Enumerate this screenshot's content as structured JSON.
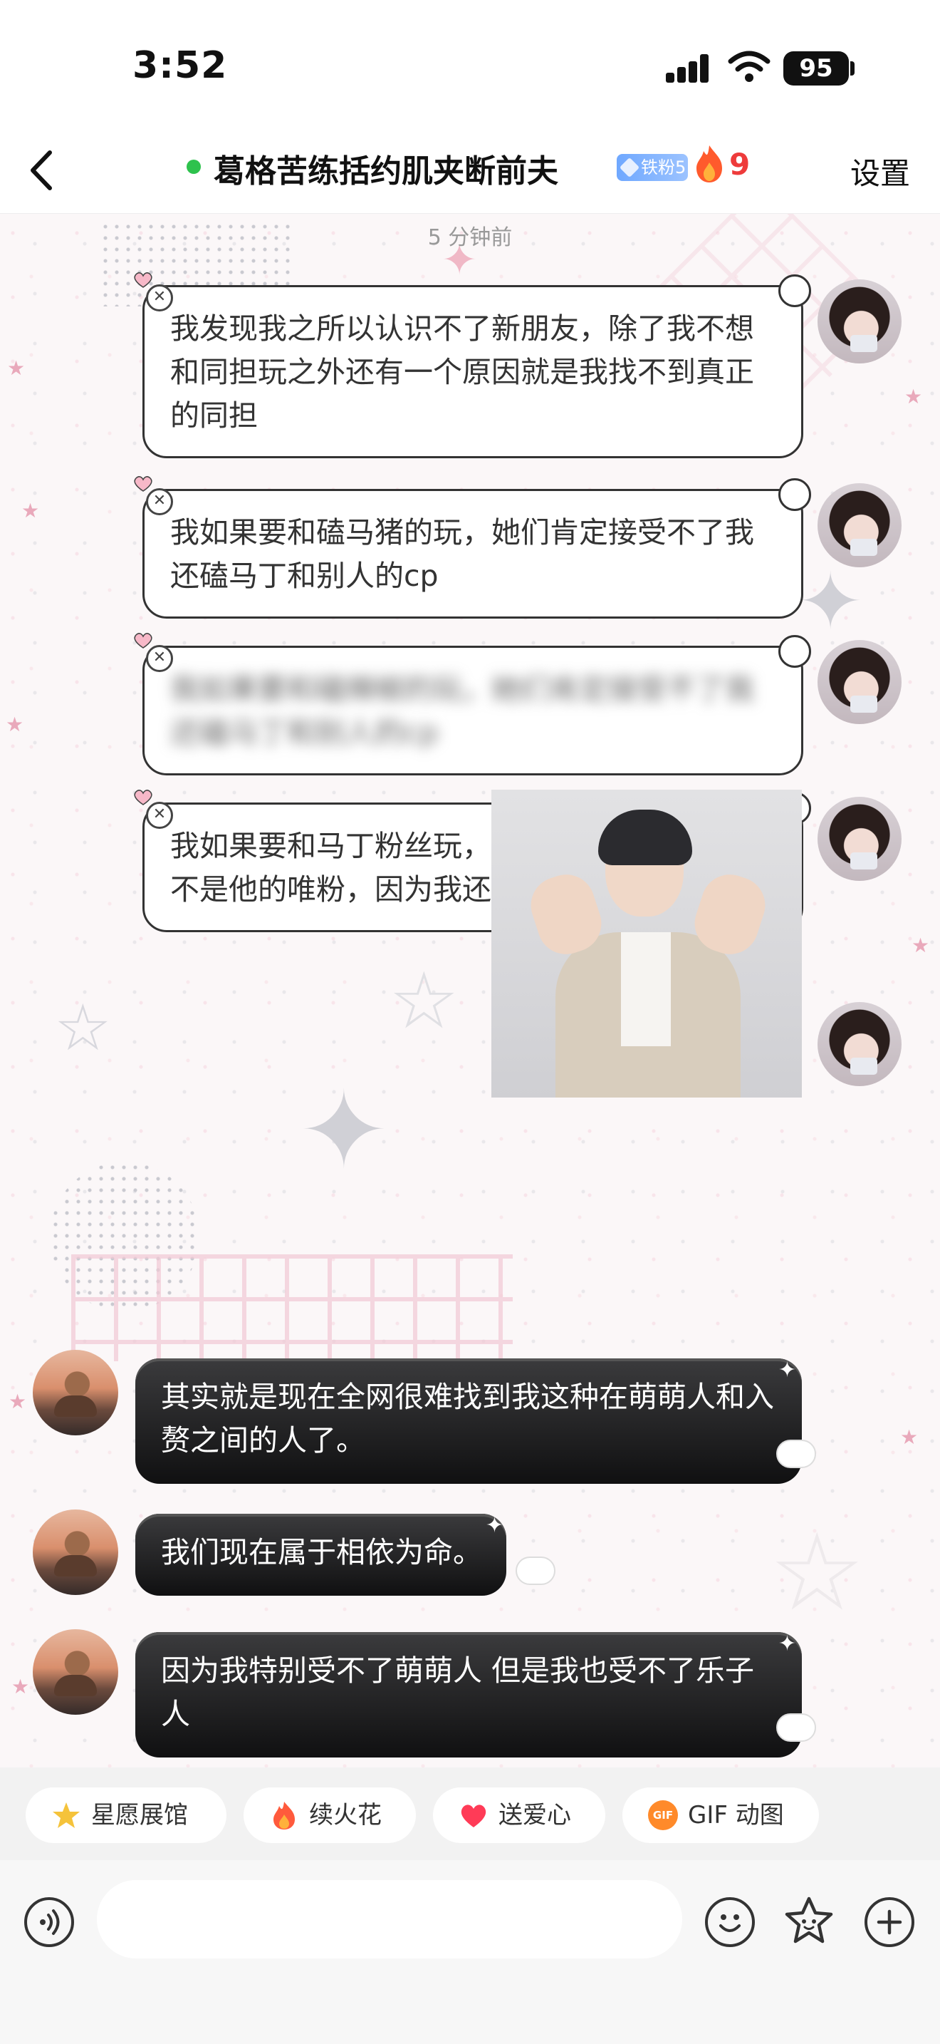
{
  "status_bar": {
    "time": "3:52",
    "battery": "95"
  },
  "header": {
    "title": "葛格苦练括约肌夹断前夫",
    "fan_badge": "铁粉5",
    "fire_count": "9",
    "settings_label": "设置"
  },
  "chat": {
    "time_label": "5 分钟前",
    "sent_messages": [
      {
        "text": "我发现我之所以认识不了新朋友，除了我不想和同担玩之外还有一个原因就是我找不到真正的同担"
      },
      {
        "text": "我如果要和磕马猪的玩，她们肯定接受不了我还磕马丁和别人的cp"
      },
      {
        "text": "我如果要和磕辣椒的玩，她们肯定接受不了我还磕马丁和别人的cp",
        "blurred": true
      },
      {
        "text": "我如果要和马丁粉丝玩，她们肯定接受不了我不是他的唯粉，因为我还好感他的队友"
      }
    ],
    "received_messages": [
      {
        "text": "其实就是现在全网很难找到我这种在萌萌人和入赘之间的人了。"
      },
      {
        "text": "我们现在属于相依为命。"
      },
      {
        "text": "因为我特别受不了萌萌人 但是我也受不了乐子人"
      }
    ]
  },
  "quick_actions": [
    {
      "label": "星愿展馆",
      "icon": "star-icon",
      "color": "#f5c33b"
    },
    {
      "label": "续火花",
      "icon": "fire-icon",
      "color": "#ff5a3c"
    },
    {
      "label": "送爱心",
      "icon": "heart-icon",
      "color": "#ff3b57"
    },
    {
      "label": "GIF 动图",
      "icon": "gif-icon",
      "color": "#ff8a2a"
    }
  ],
  "input": {
    "placeholder": ""
  },
  "colors": {
    "accent_red": "#ee3b3b",
    "online_green": "#2ec24d",
    "badge_blue": "#6fa8ff"
  }
}
